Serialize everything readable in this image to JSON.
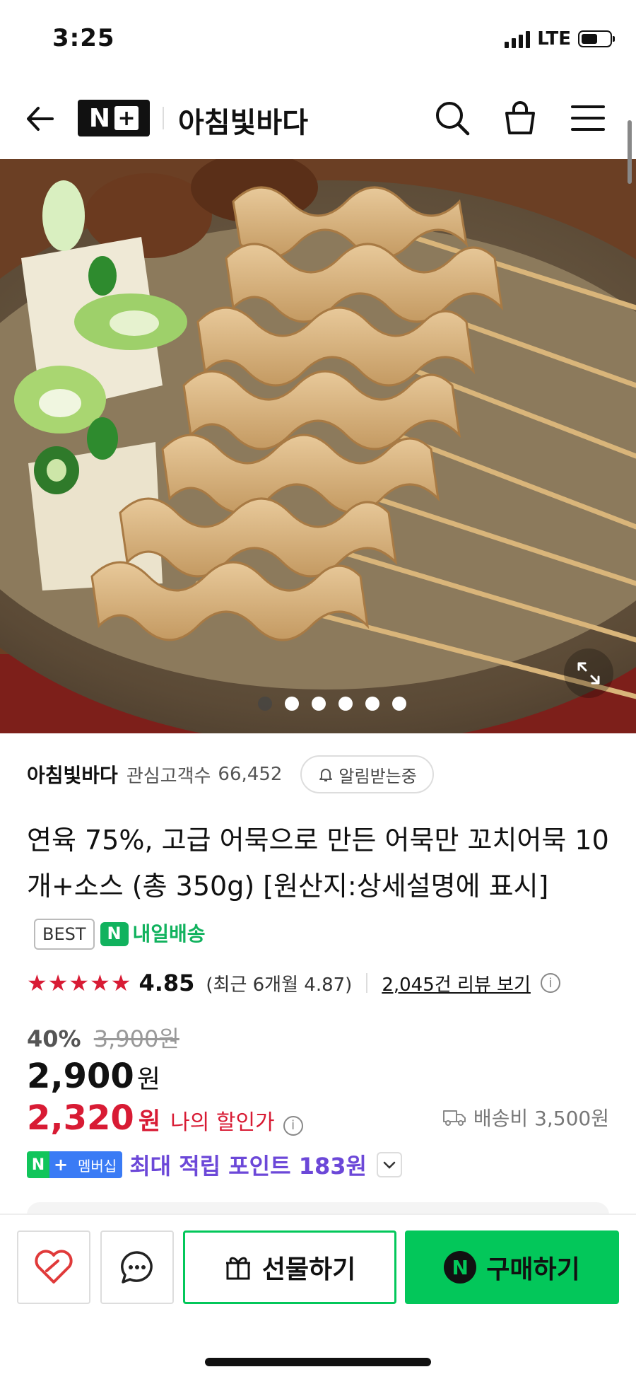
{
  "status": {
    "time": "3:25",
    "network": "LTE"
  },
  "header": {
    "brand": "N+",
    "store_name": "아침빛바다"
  },
  "hero": {
    "dot_count": 6,
    "active_index": 0
  },
  "seller": {
    "name": "아침빛바다",
    "fan_label": "관심고객수",
    "fan_count": "66,452",
    "notify_label": "알림받는중"
  },
  "product": {
    "title": "연육 75%, 고급 어묵으로 만든 어묵만 꼬치어묵 10개+소스 (총 350g) [원산지:상세설명에 표시]",
    "best_badge": "BEST",
    "delivery_badge": "내일배송",
    "delivery_badge_icon": "N"
  },
  "rating": {
    "stars": 5,
    "score": "4.85",
    "recent": "(최근 6개월 4.87)",
    "review_link": "2,045건 리뷰 보기"
  },
  "pricing": {
    "discount_rate": "40%",
    "original_price": "3,900원",
    "sale_price": "2,900",
    "currency": "원",
    "my_price": "2,320",
    "my_price_currency": "원",
    "my_price_label": "나의 할인가",
    "shipping": "배송비 3,500원"
  },
  "membership": {
    "badge_n": "N",
    "badge_plus": "+",
    "badge_label": "멤버십",
    "points_text": "최대 적립 포인트 183원"
  },
  "bottom_bar": {
    "gift_label": "선물하기",
    "buy_label": "구매하기",
    "buy_icon": "N"
  },
  "colors": {
    "naver_green": "#03c75a",
    "price_red": "#d81b34",
    "points_purple": "#6c48d8",
    "member_blue": "#3a7bf5"
  }
}
